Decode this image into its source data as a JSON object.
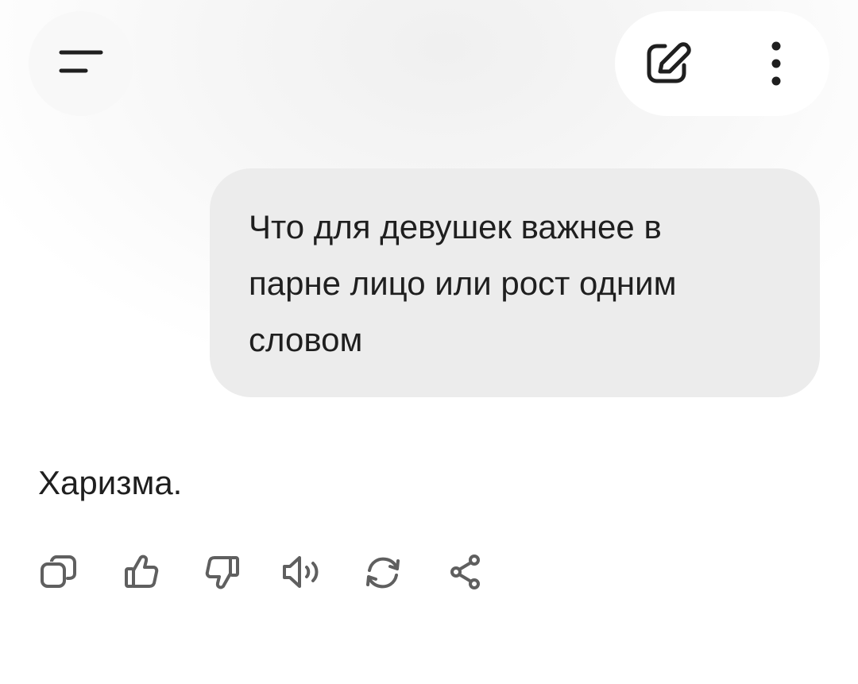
{
  "header": {
    "menu_icon": "menu-lines-icon",
    "new_chat_icon": "edit-icon",
    "more_icon": "more-vertical-icon"
  },
  "conversation": {
    "user_message": {
      "lines": [
        "Что для девушек важнее в",
        "парне лицо или рост одним",
        "словом"
      ]
    },
    "assistant_message": {
      "text": "Харизма."
    }
  },
  "message_actions": [
    {
      "icon": "copy-icon"
    },
    {
      "icon": "thumbs-up-icon"
    },
    {
      "icon": "thumbs-down-icon"
    },
    {
      "icon": "speaker-icon"
    },
    {
      "icon": "regenerate-icon"
    },
    {
      "icon": "share-icon"
    }
  ],
  "colors": {
    "bubble_background": "#ececec",
    "text": "#1f1f1f",
    "icon": "#5f5f5f"
  }
}
